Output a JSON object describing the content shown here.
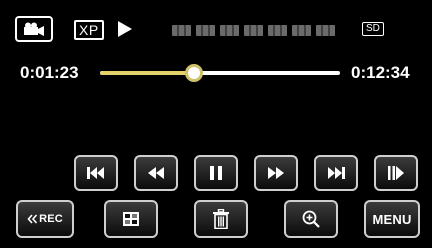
{
  "status_bar": {
    "mode_icon": "video-camera-icon",
    "quality": "XP",
    "play_status_icon": "play-icon",
    "media_badge": "SD"
  },
  "progress": {
    "elapsed": "0:01:23",
    "total": "0:12:34",
    "position_fraction": 0.39
  },
  "controls": [
    {
      "icon": "skip-to-start-icon"
    },
    {
      "icon": "rewind-icon"
    },
    {
      "icon": "pause-icon"
    },
    {
      "icon": "fast-forward-icon"
    },
    {
      "icon": "skip-to-end-icon"
    },
    {
      "icon": "slow-motion-icon"
    }
  ],
  "bottom_bar": {
    "rec_label": "REC",
    "index_icon": "index-grid-icon",
    "delete_icon": "trash-icon",
    "zoom_icon": "zoom-in-icon",
    "menu_label": "MENU"
  },
  "colors": {
    "seek_fill": "#e3d36a",
    "background": "#000000"
  }
}
